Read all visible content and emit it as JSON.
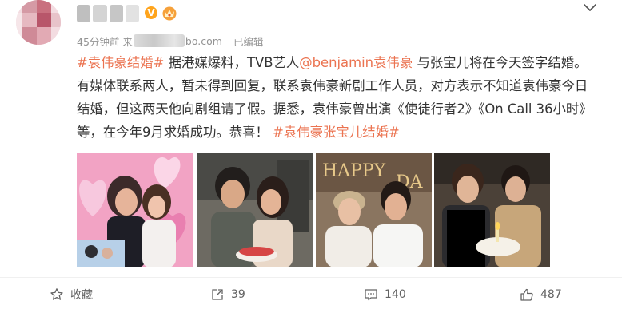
{
  "post": {
    "time": "45分钟前",
    "source_prefix": "来",
    "source_suffix": "bo.com",
    "edited": "已编辑",
    "verified_mark": "V",
    "content": {
      "tag1": "#袁伟豪结婚#",
      "t1": " 据港媒爆料，TVB艺人",
      "mention": "@benjamin袁伟豪",
      "t2": " 与张宝儿将在今天签字结婚。有媒体联系两人，暂未得到回复，联系袁伟豪新剧工作人员，对方表示不知道袁伟豪今日结婚，但这两天他向剧组请了假。据悉，袁伟豪曾出演《使徒行者2》《On Call 36小时》等，在今年9月求婚成功。恭喜！",
      "tag2": "#袁伟豪张宝儿结婚#"
    },
    "photos": [
      {
        "icon": "couple-photo-pink-hearts"
      },
      {
        "icon": "couple-photo-cake"
      },
      {
        "icon": "couple-photo-birthday-banner"
      },
      {
        "icon": "couple-photo-cake-candle"
      }
    ]
  },
  "actions": {
    "favorite": {
      "label": "收藏",
      "icon": "star-icon"
    },
    "repost": {
      "count": "39",
      "icon": "repost-icon"
    },
    "comment": {
      "count": "140",
      "icon": "comment-icon"
    },
    "like": {
      "count": "487",
      "icon": "thumbs-up-icon"
    }
  },
  "colors": {
    "link": "#eb7350",
    "meta": "#939393",
    "verified": "#ffa41c"
  }
}
